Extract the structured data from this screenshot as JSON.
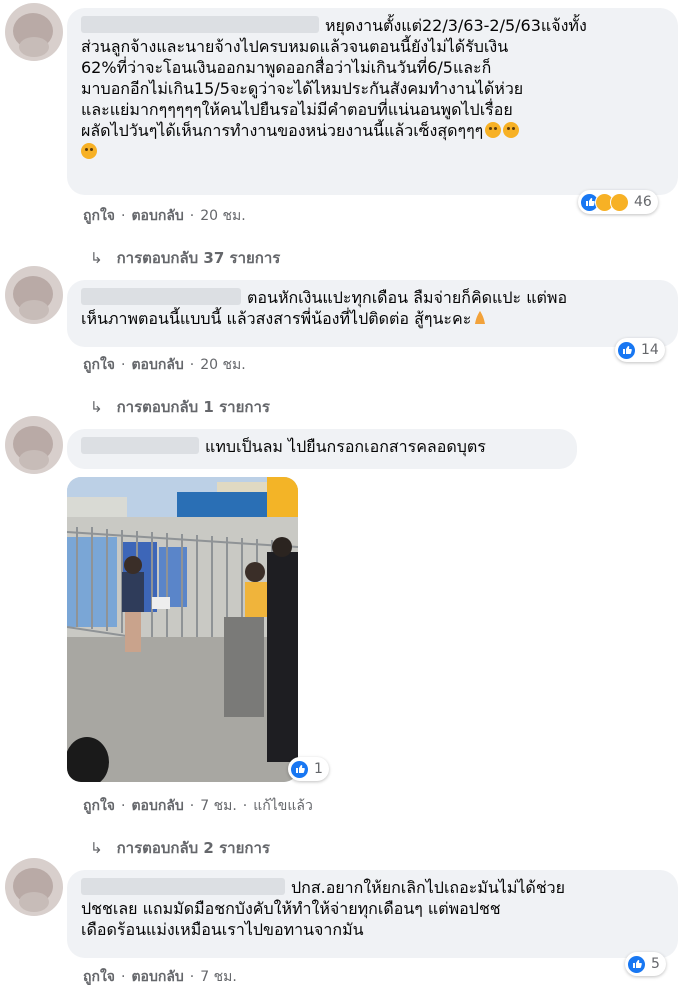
{
  "comments": [
    {
      "text": "หยุดงานตั้งแต่22/3/63-2/5/63แจ้งทั้ง\nส่วนลูกจ้างและนายจ้างไปครบหมดแล้วจนตอนนี้ยังไม่ได้รับเงิน\n62%ที่ว่าจะโอนเงินออกมาพูดออกสื่อว่าไม่เกินวันที่6/5และก็\nมาบอกอีกไม่เกิน15/5จะดูว่าจะได้ไหมประกันสังคมทำงานได้ห่วย\nและแย่มากๆๆๆๆๆให้คนไปยืนรอไม่มีคำตอบที่แน่นอนพูดไปเรื่อย\nผลัดไปวันๆได้เห็นการทำงานของหน่วยงานนี้แล้วเซ็งสุดๆๆๆ",
      "reactions_count": "46",
      "like_label": "ถูกใจ",
      "reply_label": "ตอบกลับ",
      "time": "20 ชม.",
      "replies_link": "การตอบกลับ 37 รายการ"
    },
    {
      "text": "ตอนหักเงินแปะทุกเดือน ลืมจ่ายก็คิดแปะ แต่พอ\nเห็นภาพตอนนี้แบบนี้ แล้วสงสารพี่น้องที่ไปติดต่อ สู้ๆนะคะ",
      "reactions_count": "14",
      "like_label": "ถูกใจ",
      "reply_label": "ตอบกลับ",
      "time": "20 ชม.",
      "replies_link": "การตอบกลับ 1 รายการ"
    },
    {
      "text": "แทบเป็นลม ไปยืนกรอกเอกสารคลอดบุตร",
      "reactions_count": "1",
      "like_label": "ถูกใจ",
      "reply_label": "ตอบกลับ",
      "time": "7 ชม.",
      "edited_label": "แก้ไขแล้ว",
      "replies_link": "การตอบกลับ 2 รายการ"
    },
    {
      "text": "ปกส.อยากให้ยกเลิกไปเถอะมันไม่ได้ช่วย\nปชชเลย แถมมัดมือชกบังคับให้ทำให้จ่ายทุกเดือนๆ แต่พอปชช\nเดือดร้อนแม่งเหมือนเราไปขอทานจากมัน",
      "reactions_count": "5",
      "like_label": "ถูกใจ",
      "reply_label": "ตอบกลับ",
      "time": "7 ชม."
    }
  ],
  "colors": {
    "bubble": "#f0f2f5",
    "meta_text": "#65676b",
    "like_blue": "#1877f2",
    "sad_yellow": "#f7b125"
  },
  "icons": [
    "reply-arrow-icon",
    "like-reaction-icon",
    "sad-reaction-icon",
    "care-reaction-icon",
    "crying-face-emoji",
    "praying-hands-emoji"
  ]
}
